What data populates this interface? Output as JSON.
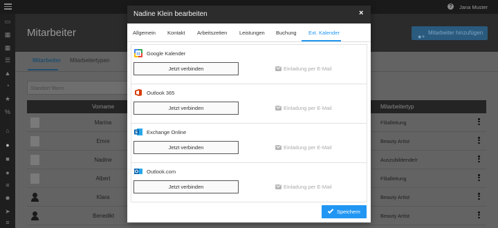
{
  "topbar": {
    "user_name": "Jana Muster",
    "help_icon": "help-icon",
    "menu_icon": "menu-icon"
  },
  "sidebar": {
    "icons": [
      "desktop-icon",
      "calendar-icon",
      "calendar-check-icon",
      "list-icon",
      "graduation-cap-icon",
      "pie-chart-icon",
      "star-icon",
      "percent-icon",
      "home-icon",
      "user-icon",
      "box-icon",
      "users-icon",
      "database-icon",
      "gear-icon",
      "paper-plane-icon",
      "sliders-icon",
      "mobile-icon"
    ]
  },
  "page": {
    "title": "Mitarbeiter",
    "add_button_label": "Mitarbeiter hinzufügen",
    "subtabs": [
      "Mitarbeiter",
      "Mitarbeitertypen"
    ],
    "filter_placeholder": "Standort filtern"
  },
  "table": {
    "headers": {
      "vorname": "Vorname",
      "typ": "Mitarbeitertyp"
    },
    "rows": [
      {
        "vorname": "Marina",
        "typ": "Filialleitung",
        "avatar": "photo"
      },
      {
        "vorname": "Emre",
        "typ": "Beauty Artist",
        "avatar": "photo"
      },
      {
        "vorname": "Nadine",
        "typ": "Auszubildende/r",
        "avatar": "photo"
      },
      {
        "vorname": "Albert",
        "typ": "Filialleitung",
        "avatar": "photo"
      },
      {
        "vorname": "Klara",
        "typ": "Beauty Artist",
        "avatar": "person"
      },
      {
        "vorname": "Benedikt",
        "typ": "Beauty Artist",
        "avatar": "person"
      }
    ]
  },
  "modal": {
    "title": "Nadine Klein bearbeiten",
    "close_label": "×",
    "tabs": [
      "Allgemein",
      "Kontakt",
      "Arbeitszeiten",
      "Leistungen",
      "Buchung",
      "Ext. Kalender"
    ],
    "active_tab": "Ext. Kalender",
    "connect_label": "Jetzt verbinden",
    "invite_label": "Einladung per E-Mail",
    "save_label": "Speichern",
    "services": [
      {
        "name": "Google Kalender",
        "icon": "google-calendar-icon"
      },
      {
        "name": "Outlook 365",
        "icon": "office-365-icon"
      },
      {
        "name": "Exchange Online",
        "icon": "exchange-icon"
      },
      {
        "name": "Outlook.com",
        "icon": "outlook-icon"
      }
    ]
  },
  "colors": {
    "accent": "#2196f3",
    "header_dark": "#2c2c2c"
  }
}
